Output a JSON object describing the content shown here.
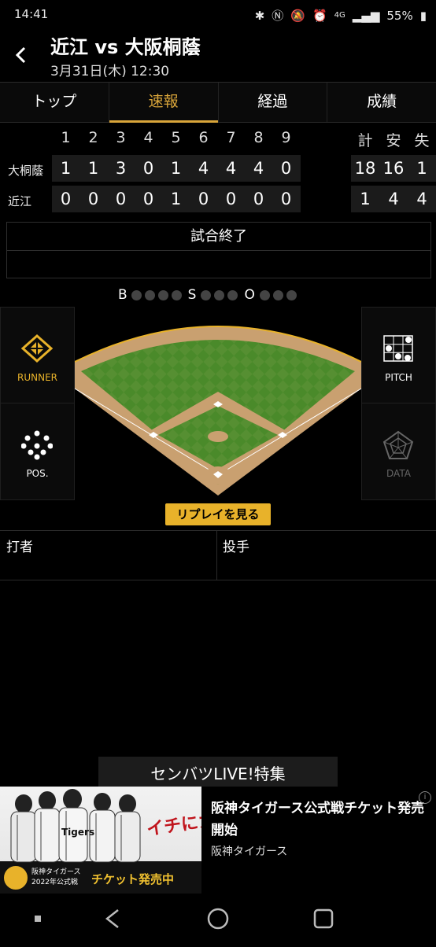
{
  "status_bar": {
    "time": "14:41",
    "battery": "55%",
    "network": "4G"
  },
  "header": {
    "title": "近江 vs 大阪桐蔭",
    "subtitle": "3月31日(木) 12:30"
  },
  "tabs": [
    {
      "label": "トップ",
      "active": false
    },
    {
      "label": "速報",
      "active": true
    },
    {
      "label": "経過",
      "active": false
    },
    {
      "label": "成績",
      "active": false
    }
  ],
  "scoreboard": {
    "innings": [
      "1",
      "2",
      "3",
      "4",
      "5",
      "6",
      "7",
      "8",
      "9"
    ],
    "total_headers": [
      "計",
      "安",
      "失"
    ],
    "teams": [
      {
        "name": "大桐蔭",
        "scores": [
          "1",
          "1",
          "3",
          "0",
          "1",
          "4",
          "4",
          "4",
          "0"
        ],
        "totals": [
          "18",
          "16",
          "1"
        ]
      },
      {
        "name": "近江",
        "scores": [
          "0",
          "0",
          "0",
          "0",
          "1",
          "0",
          "0",
          "0",
          "0"
        ],
        "totals": [
          "1",
          "4",
          "4"
        ]
      }
    ]
  },
  "game_status": "試合終了",
  "count": {
    "b_label": "B",
    "s_label": "S",
    "o_label": "O"
  },
  "side_buttons": {
    "runner": "RUNNER",
    "pos": "POS.",
    "pitch": "PITCH",
    "data": "DATA"
  },
  "replay_label": "リプレイを見る",
  "batter_label": "打者",
  "pitcher_label": "投手",
  "senbatsu_label": "センバツLIVE!特集",
  "ad": {
    "title": "阪神タイガース公式戦チケット発売開始",
    "sponsor": "阪神タイガース",
    "banner_line1": "阪神タイガース",
    "banner_line2": "2022年公式戦",
    "banner_cta": "チケット発売中",
    "banner_slogan": "イチにカケル!",
    "info_icon": "i"
  },
  "colors": {
    "accent": "#d9a53a",
    "replay_bg": "#e8b22a",
    "field_green": "#4d8a2c",
    "dirt": "#c9a070"
  }
}
